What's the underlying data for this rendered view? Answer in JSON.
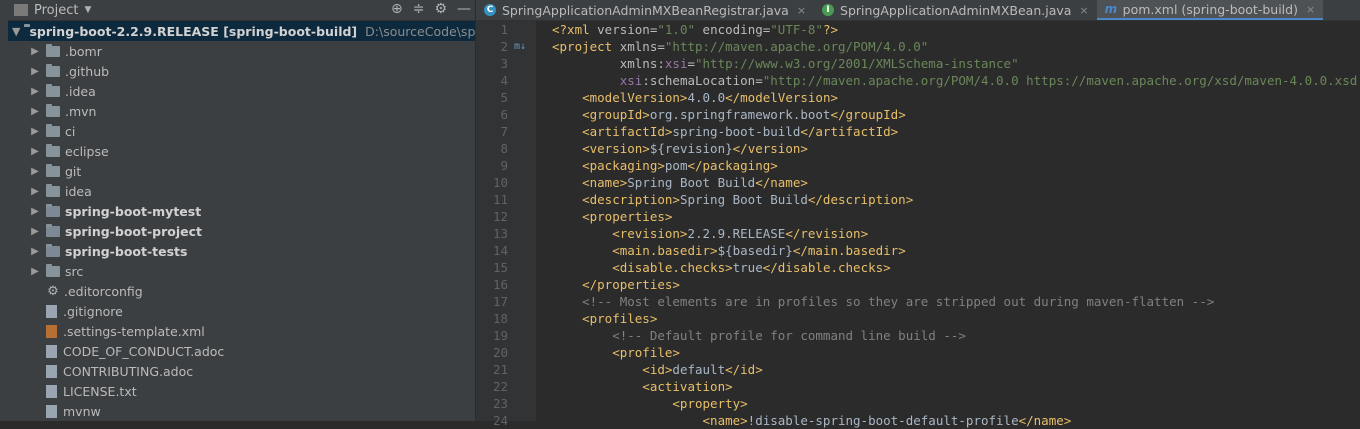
{
  "project_panel": {
    "title": "Project",
    "dropdown_glyph": "▼",
    "tools": [
      "⊕",
      "≑",
      "⚙",
      "—"
    ],
    "root": {
      "name": "spring-boot-2.2.9.RELEASE [spring-boot-build]",
      "path": "D:\\sourceCode\\spring-bo"
    },
    "items": [
      {
        "name": ".bomr",
        "type": "folder",
        "bold": false
      },
      {
        "name": ".github",
        "type": "folder",
        "bold": false
      },
      {
        "name": ".idea",
        "type": "folder",
        "bold": false
      },
      {
        "name": ".mvn",
        "type": "folder",
        "bold": false
      },
      {
        "name": "ci",
        "type": "folder",
        "bold": false
      },
      {
        "name": "eclipse",
        "type": "folder",
        "bold": false
      },
      {
        "name": "git",
        "type": "folder",
        "bold": false
      },
      {
        "name": "idea",
        "type": "folder",
        "bold": false
      },
      {
        "name": "spring-boot-mytest",
        "type": "folder",
        "bold": true
      },
      {
        "name": "spring-boot-project",
        "type": "folder",
        "bold": true
      },
      {
        "name": "spring-boot-tests",
        "type": "folder",
        "bold": true
      },
      {
        "name": "src",
        "type": "folder",
        "bold": false
      },
      {
        "name": ".editorconfig",
        "type": "gear",
        "bold": false
      },
      {
        "name": ".gitignore",
        "type": "file",
        "bold": false
      },
      {
        "name": ".settings-template.xml",
        "type": "xml",
        "bold": false
      },
      {
        "name": "CODE_OF_CONDUCT.adoc",
        "type": "file",
        "bold": false
      },
      {
        "name": "CONTRIBUTING.adoc",
        "type": "file",
        "bold": false
      },
      {
        "name": "LICENSE.txt",
        "type": "file",
        "bold": false
      },
      {
        "name": "mvnw",
        "type": "file",
        "bold": false
      }
    ]
  },
  "tabs": [
    {
      "label": "SpringApplicationAdminMXBeanRegistrar.java",
      "icon": "C",
      "icon_color": "#3592c4",
      "active": false
    },
    {
      "label": "SpringApplicationAdminMXBean.java",
      "icon": "I",
      "icon_color": "#499c54",
      "active": false
    },
    {
      "label": "pom.xml (spring-boot-build)",
      "icon": "m",
      "icon_color": "#4a88c7",
      "active": true
    }
  ],
  "close_glyph": "×",
  "code_lines": [
    {
      "n": "1",
      "mark": "",
      "segs": [
        [
          "t",
          "<?xml "
        ],
        [
          "a",
          "version="
        ],
        [
          "v",
          "\"1.0\""
        ],
        [
          "a",
          " encoding="
        ],
        [
          "v",
          "\"UTF-8\""
        ],
        [
          "t",
          "?>"
        ]
      ]
    },
    {
      "n": "2",
      "mark": "m↓",
      "segs": [
        [
          "t",
          "<project "
        ],
        [
          "a",
          "xmlns="
        ],
        [
          "v",
          "\"http://maven.apache.org/POM/4.0.0\""
        ]
      ]
    },
    {
      "n": "3",
      "mark": "",
      "segs": [
        [
          "a",
          "         xmlns:"
        ],
        [
          "ns",
          "xsi"
        ],
        [
          "a",
          "="
        ],
        [
          "v",
          "\"http://www.w3.org/2001/XMLSchema-instance\""
        ]
      ]
    },
    {
      "n": "4",
      "mark": "",
      "segs": [
        [
          "ns",
          "         xsi"
        ],
        [
          "a",
          ":schemaLocation="
        ],
        [
          "v",
          "\"http://maven.apache.org/POM/4.0.0 https://maven.apache.org/xsd/maven-4.0.0.xsd"
        ]
      ]
    },
    {
      "n": "5",
      "mark": "",
      "segs": [
        [
          "t",
          "    <modelVersion>"
        ],
        [
          "txt",
          "4.0.0"
        ],
        [
          "t",
          "</modelVersion>"
        ]
      ]
    },
    {
      "n": "6",
      "mark": "",
      "segs": [
        [
          "t",
          "    <groupId>"
        ],
        [
          "txt",
          "org.springframework.boot"
        ],
        [
          "t",
          "</groupId>"
        ]
      ]
    },
    {
      "n": "7",
      "mark": "",
      "segs": [
        [
          "t",
          "    <artifactId>"
        ],
        [
          "txt",
          "spring-boot-build"
        ],
        [
          "t",
          "</artifactId>"
        ]
      ]
    },
    {
      "n": "8",
      "mark": "",
      "segs": [
        [
          "t",
          "    <version>"
        ],
        [
          "txt",
          "${revision}"
        ],
        [
          "t",
          "</version>"
        ]
      ]
    },
    {
      "n": "9",
      "mark": "",
      "segs": [
        [
          "t",
          "    <packaging>"
        ],
        [
          "txt",
          "pom"
        ],
        [
          "t",
          "</packaging>"
        ]
      ]
    },
    {
      "n": "10",
      "mark": "",
      "segs": [
        [
          "t",
          "    <name>"
        ],
        [
          "txt",
          "Spring Boot Build"
        ],
        [
          "t",
          "</name>"
        ]
      ]
    },
    {
      "n": "11",
      "mark": "",
      "segs": [
        [
          "t",
          "    <description>"
        ],
        [
          "txt",
          "Spring Boot Build"
        ],
        [
          "t",
          "</description>"
        ]
      ]
    },
    {
      "n": "12",
      "mark": "",
      "segs": [
        [
          "t",
          "    <properties>"
        ]
      ]
    },
    {
      "n": "13",
      "mark": "",
      "segs": [
        [
          "t",
          "        <revision>"
        ],
        [
          "txt",
          "2.2.9.RELEASE"
        ],
        [
          "t",
          "</revision>"
        ]
      ]
    },
    {
      "n": "14",
      "mark": "",
      "segs": [
        [
          "t",
          "        <main.basedir>"
        ],
        [
          "txt",
          "${basedir}"
        ],
        [
          "t",
          "</main.basedir>"
        ]
      ]
    },
    {
      "n": "15",
      "mark": "",
      "segs": [
        [
          "t",
          "        <disable.checks>"
        ],
        [
          "txt",
          "true"
        ],
        [
          "t",
          "</disable.checks>"
        ]
      ]
    },
    {
      "n": "16",
      "mark": "",
      "segs": [
        [
          "t",
          "    </properties>"
        ]
      ]
    },
    {
      "n": "17",
      "mark": "",
      "segs": [
        [
          "c",
          "    <!-- Most elements are in profiles so they are stripped out during maven-flatten -->"
        ]
      ]
    },
    {
      "n": "18",
      "mark": "",
      "segs": [
        [
          "t",
          "    <profiles>"
        ]
      ]
    },
    {
      "n": "19",
      "mark": "",
      "segs": [
        [
          "c",
          "        <!-- Default profile for command line build -->"
        ]
      ]
    },
    {
      "n": "20",
      "mark": "",
      "segs": [
        [
          "t",
          "        <profile>"
        ]
      ]
    },
    {
      "n": "21",
      "mark": "",
      "segs": [
        [
          "t",
          "            <id>"
        ],
        [
          "txt",
          "default"
        ],
        [
          "t",
          "</id>"
        ]
      ]
    },
    {
      "n": "22",
      "mark": "",
      "segs": [
        [
          "t",
          "            <activation>"
        ]
      ]
    },
    {
      "n": "23",
      "mark": "",
      "segs": [
        [
          "t",
          "                <property>"
        ]
      ]
    },
    {
      "n": "24",
      "mark": "",
      "segs": [
        [
          "t",
          "                    <name>"
        ],
        [
          "txt",
          "!disable-spring-boot-default-profile"
        ],
        [
          "t",
          "</name>"
        ]
      ]
    }
  ]
}
